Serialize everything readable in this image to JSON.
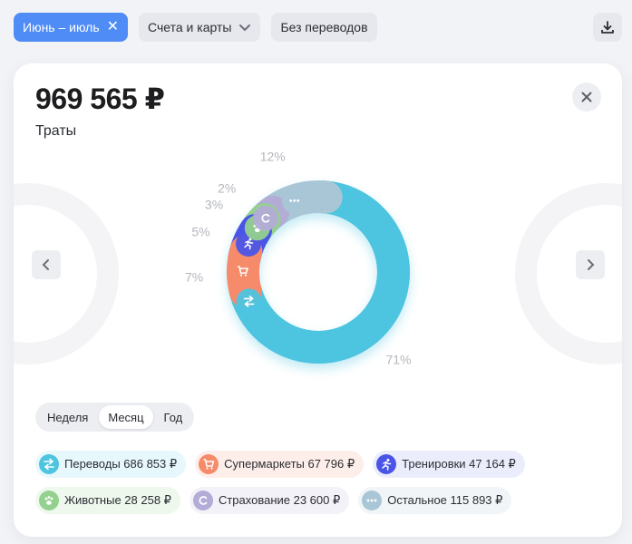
{
  "filters": {
    "period_label": "Июнь – июль",
    "accounts_label": "Счета и карты",
    "transfers_label": "Без переводов"
  },
  "card": {
    "amount": "969 565 ₽",
    "subtitle": "Траты"
  },
  "period_tabs": [
    "Неделя",
    "Месяц",
    "Год"
  ],
  "active_period_tab": "Месяц",
  "colors": {
    "accent": "#4f8cf5",
    "transfers": "#4dc4e0",
    "supermarkets": "#f58b6a",
    "sport": "#4a55e8",
    "pets": "#94d18e",
    "insurance": "#b3acd6",
    "other": "#a9c6d6"
  },
  "chart_data": {
    "type": "pie",
    "labels": [
      "Переводы",
      "Супермаркеты",
      "Тренировки",
      "Животные",
      "Страхование",
      "Остальное"
    ],
    "values": [
      686853,
      67796,
      47164,
      28258,
      23600,
      115893
    ],
    "percent_labels": [
      "71%",
      "7%",
      "5%",
      "3%",
      "2%",
      "12%"
    ],
    "currency": "₽",
    "icons": [
      "transfer-icon",
      "cart-icon",
      "runner-icon",
      "paw-icon",
      "insurance-c-icon",
      "more-dots-icon"
    ]
  },
  "legend": [
    {
      "label": "Переводы 686 853 ₽",
      "icon": "transfer-icon"
    },
    {
      "label": "Супермаркеты 67 796 ₽",
      "icon": "cart-icon"
    },
    {
      "label": "Тренировки 47 164 ₽",
      "icon": "runner-icon"
    },
    {
      "label": "Животные 28 258 ₽",
      "icon": "paw-icon"
    },
    {
      "label": "Страхование 23 600 ₽",
      "icon": "insurance-c-icon"
    },
    {
      "label": "Остальное 115 893 ₽",
      "icon": "more-dots-icon"
    }
  ]
}
